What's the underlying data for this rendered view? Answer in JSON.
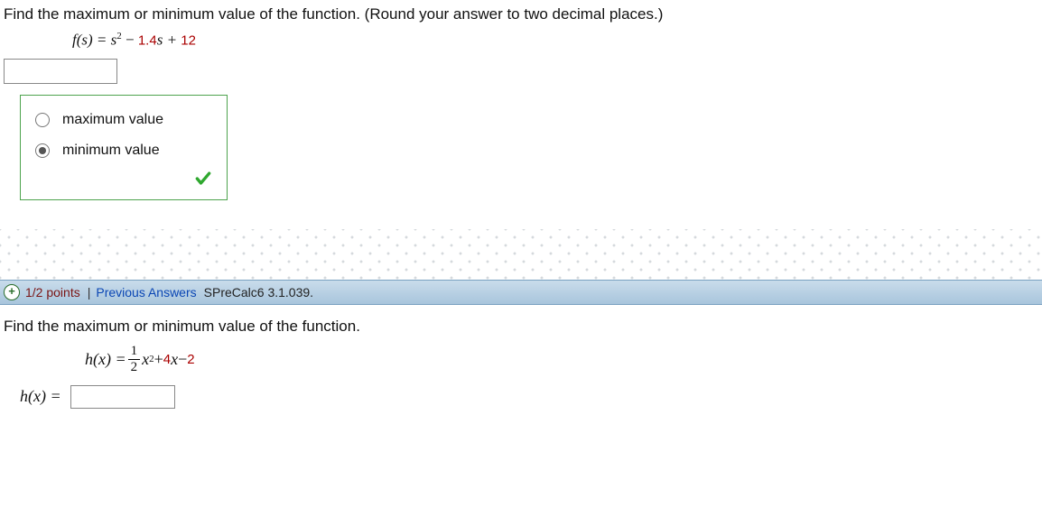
{
  "q1": {
    "prompt": "Find the maximum or minimum value of the function. (Round your answer to two decimal places.)",
    "eq_lhs": "f(s) = s",
    "eq_sup": "2",
    "eq_mid": " − ",
    "eq_coef": "1.4",
    "eq_after_coef": "s + ",
    "eq_const": "12",
    "opt_max": "maximum value",
    "opt_min": "minimum value"
  },
  "header": {
    "points": "1/2 points",
    "sep": "|",
    "link": "Previous Answers",
    "ref": "SPreCalc6 3.1.039."
  },
  "q2": {
    "prompt": "Find the maximum or minimum value of the function.",
    "eq_lhs": "h(x) = ",
    "frac_top": "1",
    "frac_bot": "2",
    "eq_x": "x",
    "eq_sup": "2",
    "eq_mid1": " + ",
    "eq_coef1": "4",
    "eq_x2": "x",
    "eq_mid2": " − ",
    "eq_const": "2",
    "answer_label": "h(x) = "
  }
}
